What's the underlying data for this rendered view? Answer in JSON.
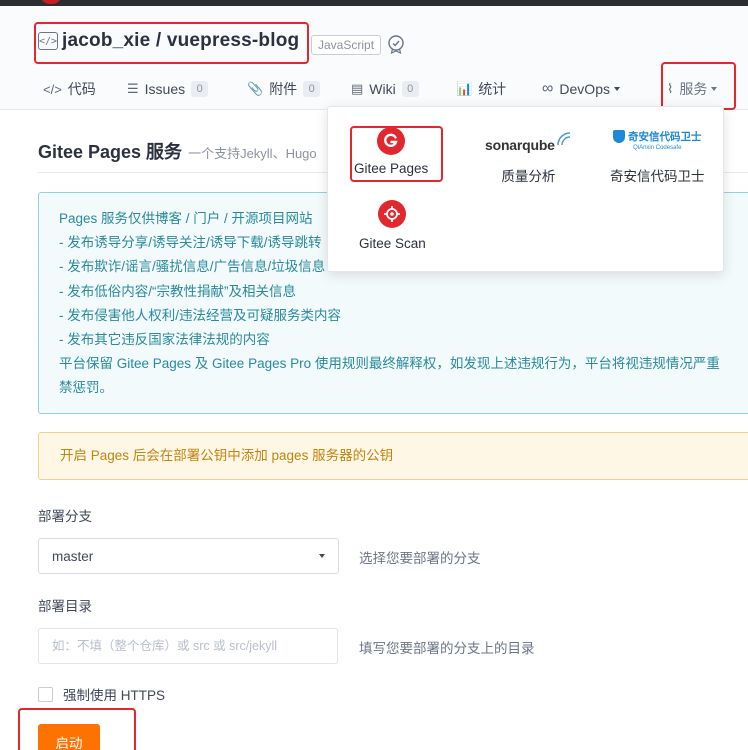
{
  "repo": {
    "owner": "jacob_xie",
    "separator": " / ",
    "name": "vuepress-blog",
    "language": "JavaScript"
  },
  "tabs": [
    {
      "icon": "</>",
      "label": "代码"
    },
    {
      "icon": "☰",
      "label": "Issues",
      "count": "0"
    },
    {
      "icon": "📎",
      "label": "附件",
      "count": "0"
    },
    {
      "icon": "▤",
      "label": "Wiki",
      "count": "0"
    },
    {
      "icon": "📊",
      "label": "统计"
    },
    {
      "icon": "∞",
      "label": "DevOps"
    },
    {
      "icon": "⌇",
      "label": "服务"
    }
  ],
  "page": {
    "title": "Gitee Pages 服务",
    "subtitle": "一个支持Jekyll、Hugo"
  },
  "notice": {
    "lines": [
      "Pages 服务仅供博客 / 门户 / 开源项目网站",
      "- 发布诱导分享/诱导关注/诱导下载/诱导跳转",
      "- 发布欺诈/谣言/骚扰信息/广告信息/垃圾信息",
      "- 发布低俗内容/“宗教性捐献”及相关信息",
      "- 发布侵害他人权利/违法经营及可疑服务类内容",
      "- 发布其它违反国家法律法规的内容",
      "平台保留 Gitee Pages 及 Gitee Pages Pro 使用规则最终解释权，如发现上述违规行为，平台将视违规情况严重",
      "禁惩罚。"
    ]
  },
  "warning": "开启 Pages 后会在部署公钥中添加 pages 服务器的公钥",
  "form": {
    "branch_label": "部署分支",
    "branch_value": "master",
    "branch_hint": "选择您要部署的分支",
    "dir_label": "部署目录",
    "dir_placeholder": "如：不填（整个仓库）或 src 或 src/jekyll",
    "dir_hint": "填写您要部署的分支上的目录",
    "https_label": "强制使用 HTTPS",
    "start_button": "启动"
  },
  "services_menu": {
    "items": [
      {
        "label": "Gitee Pages"
      },
      {
        "label": "质量分析",
        "logo_text": "sonarqube"
      },
      {
        "label": "奇安信代码卫士",
        "logo_text": "奇安信代码卫士",
        "logo_subtext": "QiAnxin Codesafe"
      },
      {
        "label": "Gitee Scan"
      }
    ]
  },
  "colors": {
    "primary": "#fe7300",
    "highlight": "#e5262a",
    "notice_text": "#2a8a9c",
    "warning_text": "#c28410",
    "brand_red": "#e0282e"
  }
}
